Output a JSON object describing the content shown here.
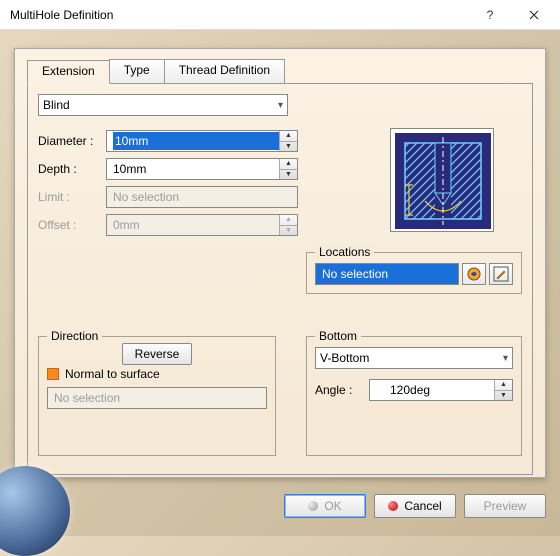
{
  "title": "MultiHole Definition",
  "tabs": {
    "extension": "Extension",
    "type": "Type",
    "thread": "Thread Definition"
  },
  "holeType": "Blind",
  "params": {
    "diameter_label": "Diameter :",
    "diameter_value": "10mm",
    "depth_label": "Depth :",
    "depth_value": "10mm",
    "limit_label": "Limit :",
    "limit_value": "No selection",
    "offset_label": "Offset :",
    "offset_value": "0mm"
  },
  "locations": {
    "title": "Locations",
    "value": "No selection"
  },
  "direction": {
    "title": "Direction",
    "reverse": "Reverse",
    "normal": "Normal to surface",
    "selection": "No selection"
  },
  "bottom": {
    "title": "Bottom",
    "type": "V-Bottom",
    "angle_label": "Angle :",
    "angle_value": "120deg"
  },
  "buttons": {
    "ok": "OK",
    "cancel": "Cancel",
    "preview": "Preview"
  }
}
